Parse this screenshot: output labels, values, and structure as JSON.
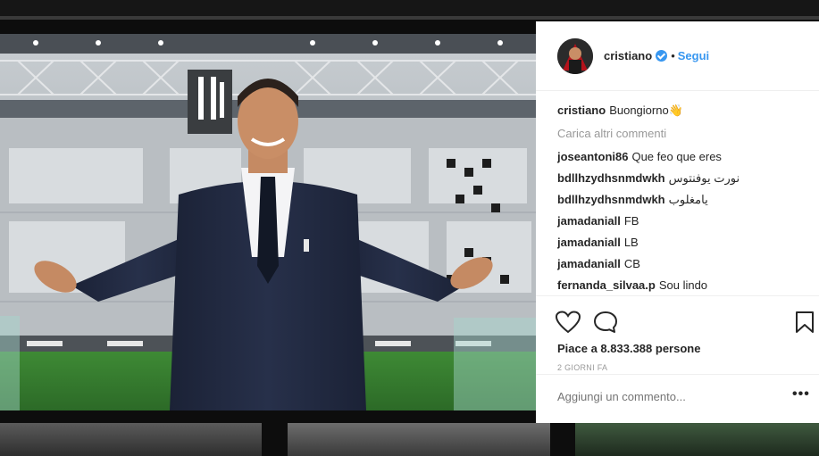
{
  "post": {
    "username": "cristiano",
    "separator": "•",
    "follow_label": "Segui",
    "caption": {
      "user": "cristiano",
      "text": "Buongiorno👋"
    },
    "load_more": "Carica altri commenti",
    "comments": [
      {
        "user": "joseantoni86",
        "text": "Que feo que eres"
      },
      {
        "user": "bdllhzydhsnmdwkh",
        "text": "نورت يوفنتوس"
      },
      {
        "user": "bdllhzydhsnmdwkh",
        "text": "يامغلوب"
      },
      {
        "user": "jamadaniall",
        "text": "FB"
      },
      {
        "user": "jamadaniall",
        "text": "LB"
      },
      {
        "user": "jamadaniall",
        "text": "CB"
      },
      {
        "user": "fernanda_silvaa.p",
        "text": "Sou lindo"
      }
    ],
    "likes": "Piace a 8.833.388 persone",
    "timestamp": "2 GIORNI FA",
    "add_comment_placeholder": "Aggiungi un commento...",
    "more_options": "•••"
  },
  "icons": {
    "verified": "verified-badge-icon",
    "like": "heart-icon",
    "comment": "comment-bubble-icon",
    "save": "bookmark-icon"
  },
  "colors": {
    "accent": "#3897f0",
    "text": "#262626",
    "muted": "#999999",
    "divider": "#efefef"
  }
}
